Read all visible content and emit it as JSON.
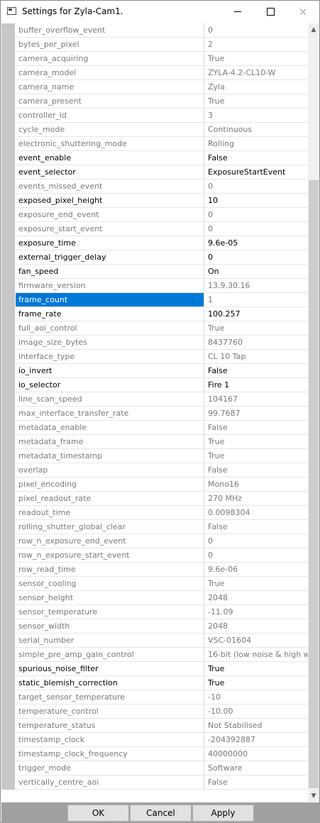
{
  "window": {
    "title": "Settings for Zyla-Cam1.",
    "close_glyph": "✕"
  },
  "properties": [
    {
      "name": "buffer_overflow_event",
      "value": "0",
      "editable": false
    },
    {
      "name": "bytes_per_pixel",
      "value": "2",
      "editable": false
    },
    {
      "name": "camera_acquiring",
      "value": "True",
      "editable": false
    },
    {
      "name": "camera_model",
      "value": "ZYLA-4.2-CL10-W",
      "editable": false
    },
    {
      "name": "camera_name",
      "value": "Zyla",
      "editable": false
    },
    {
      "name": "camera_present",
      "value": "True",
      "editable": false
    },
    {
      "name": "controller_id",
      "value": "3",
      "editable": false
    },
    {
      "name": "cycle_mode",
      "value": "Continuous",
      "editable": false
    },
    {
      "name": "electronic_shuttering_mode",
      "value": "Rolling",
      "editable": false
    },
    {
      "name": "event_enable",
      "value": "False",
      "editable": true
    },
    {
      "name": "event_selector",
      "value": "ExposureStartEvent",
      "editable": true
    },
    {
      "name": "events_missed_event",
      "value": "0",
      "editable": false
    },
    {
      "name": "exposed_pixel_height",
      "value": "10",
      "editable": true
    },
    {
      "name": "exposure_end_event",
      "value": "0",
      "editable": false
    },
    {
      "name": "exposure_start_event",
      "value": "0",
      "editable": false
    },
    {
      "name": "exposure_time",
      "value": "9.6e-05",
      "editable": true
    },
    {
      "name": "external_trigger_delay",
      "value": "0",
      "editable": true
    },
    {
      "name": "fan_speed",
      "value": "On",
      "editable": true
    },
    {
      "name": "firmware_version",
      "value": "13.9.30.16",
      "editable": false
    },
    {
      "name": "frame_count",
      "value": "1",
      "editable": false,
      "selected": true
    },
    {
      "name": "frame_rate",
      "value": "100.257",
      "editable": true
    },
    {
      "name": "full_aoi_control",
      "value": "True",
      "editable": false
    },
    {
      "name": "image_size_bytes",
      "value": "8437760",
      "editable": false
    },
    {
      "name": "interface_type",
      "value": "CL 10 Tap",
      "editable": false
    },
    {
      "name": "io_invert",
      "value": "False",
      "editable": true
    },
    {
      "name": "io_selector",
      "value": "Fire 1",
      "editable": true
    },
    {
      "name": "line_scan_speed",
      "value": "104167",
      "editable": false
    },
    {
      "name": "max_interface_transfer_rate",
      "value": "99.7687",
      "editable": false
    },
    {
      "name": "metadata_enable",
      "value": "False",
      "editable": false
    },
    {
      "name": "metadata_frame",
      "value": "True",
      "editable": false
    },
    {
      "name": "metadata_timestamp",
      "value": "True",
      "editable": false
    },
    {
      "name": "overlap",
      "value": "False",
      "editable": false
    },
    {
      "name": "pixel_encoding",
      "value": "Mono16",
      "editable": false
    },
    {
      "name": "pixel_readout_rate",
      "value": "270 MHz",
      "editable": false
    },
    {
      "name": "readout_time",
      "value": "0.0098304",
      "editable": false
    },
    {
      "name": "rolling_shutter_global_clear",
      "value": "False",
      "editable": false
    },
    {
      "name": "row_n_exposure_end_event",
      "value": "0",
      "editable": false
    },
    {
      "name": "row_n_exposure_start_event",
      "value": "0",
      "editable": false
    },
    {
      "name": "row_read_time",
      "value": "9.6e-06",
      "editable": false
    },
    {
      "name": "sensor_cooling",
      "value": "True",
      "editable": false
    },
    {
      "name": "sensor_height",
      "value": "2048",
      "editable": false
    },
    {
      "name": "sensor_temperature",
      "value": "-11.09",
      "editable": false
    },
    {
      "name": "sensor_width",
      "value": "2048",
      "editable": false
    },
    {
      "name": "serial_number",
      "value": "VSC-01604",
      "editable": false
    },
    {
      "name": "simple_pre_amp_gain_control",
      "value": "16-bit (low noise & high w",
      "editable": false
    },
    {
      "name": "spurious_noise_filter",
      "value": "True",
      "editable": true
    },
    {
      "name": "static_blemish_correction",
      "value": "True",
      "editable": true
    },
    {
      "name": "target_sensor_temperature",
      "value": "-10",
      "editable": false
    },
    {
      "name": "temperature_control",
      "value": "-10.00",
      "editable": false
    },
    {
      "name": "temperature_status",
      "value": "Not Stabilised",
      "editable": false
    },
    {
      "name": "timestamp_clock",
      "value": "-204392887",
      "editable": false
    },
    {
      "name": "timestamp_clock_frequency",
      "value": "40000000",
      "editable": false
    },
    {
      "name": "trigger_mode",
      "value": "Software",
      "editable": false
    },
    {
      "name": "vertically_centre_aoi",
      "value": "False",
      "editable": false
    }
  ],
  "footer": {
    "ok_label": "OK",
    "cancel_label": "Cancel",
    "apply_label": "Apply"
  },
  "colors": {
    "selection": "#0078d7",
    "readonly_text": "#7a7a7a",
    "editable_text": "#000000"
  }
}
